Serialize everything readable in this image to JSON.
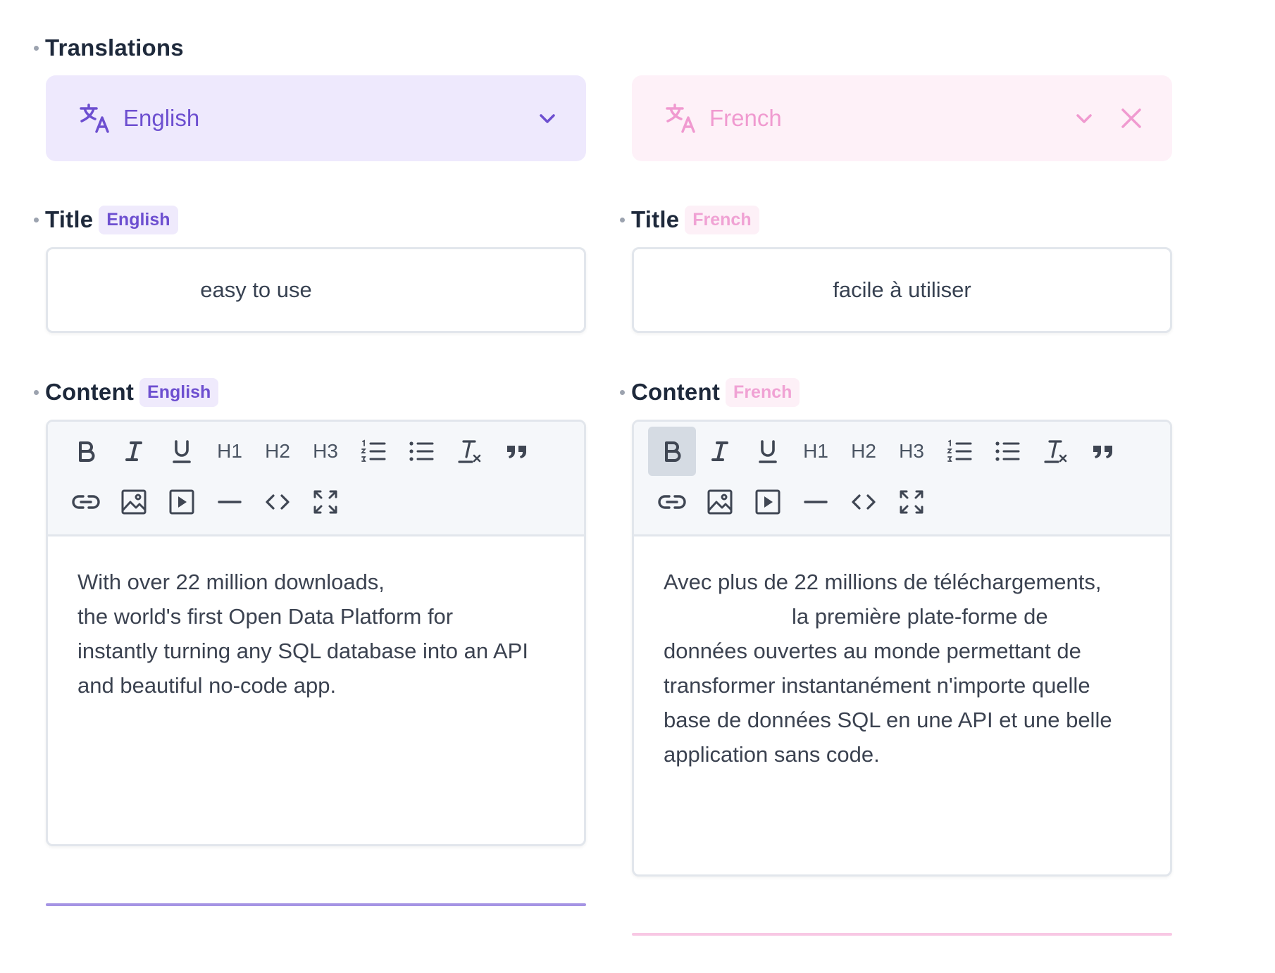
{
  "section": {
    "title": "Translations"
  },
  "left": {
    "language": "English",
    "title_label": "Title",
    "title_badge": "English",
    "title_value": "easy to use",
    "content_label": "Content",
    "content_badge": "English",
    "content_lines": [
      "With over 22 million downloads,",
      "the world's first Open Data Platform for",
      "instantly turning any SQL database into an API",
      "and beautiful no-code app."
    ],
    "accent": "#6d4fd0"
  },
  "right": {
    "language": "French",
    "title_label": "Title",
    "title_badge": "French",
    "title_value": "facile à utiliser",
    "content_label": "Content",
    "content_badge": "French",
    "content_lines": [
      "Avec plus de 22 millions de téléchargements,",
      "la première plate-forme de",
      "données ouvertes au monde permettant de",
      "transformer instantanément n'importe quelle",
      "base de données SQL en une API et une belle",
      "application sans code."
    ],
    "accent": "#f09ad0"
  },
  "toolbar": {
    "h1": "H1",
    "h2": "H2",
    "h3": "H3",
    "icons_row1": [
      "bold-icon",
      "italic-icon",
      "underline-icon",
      "heading-1",
      "heading-2",
      "heading-3",
      "ordered-list-icon",
      "bullet-list-icon",
      "clear-format-icon",
      "quote-icon"
    ],
    "icons_row2": [
      "link-icon",
      "image-icon",
      "video-icon",
      "horizontal-rule-icon",
      "code-icon",
      "fullscreen-icon"
    ]
  }
}
